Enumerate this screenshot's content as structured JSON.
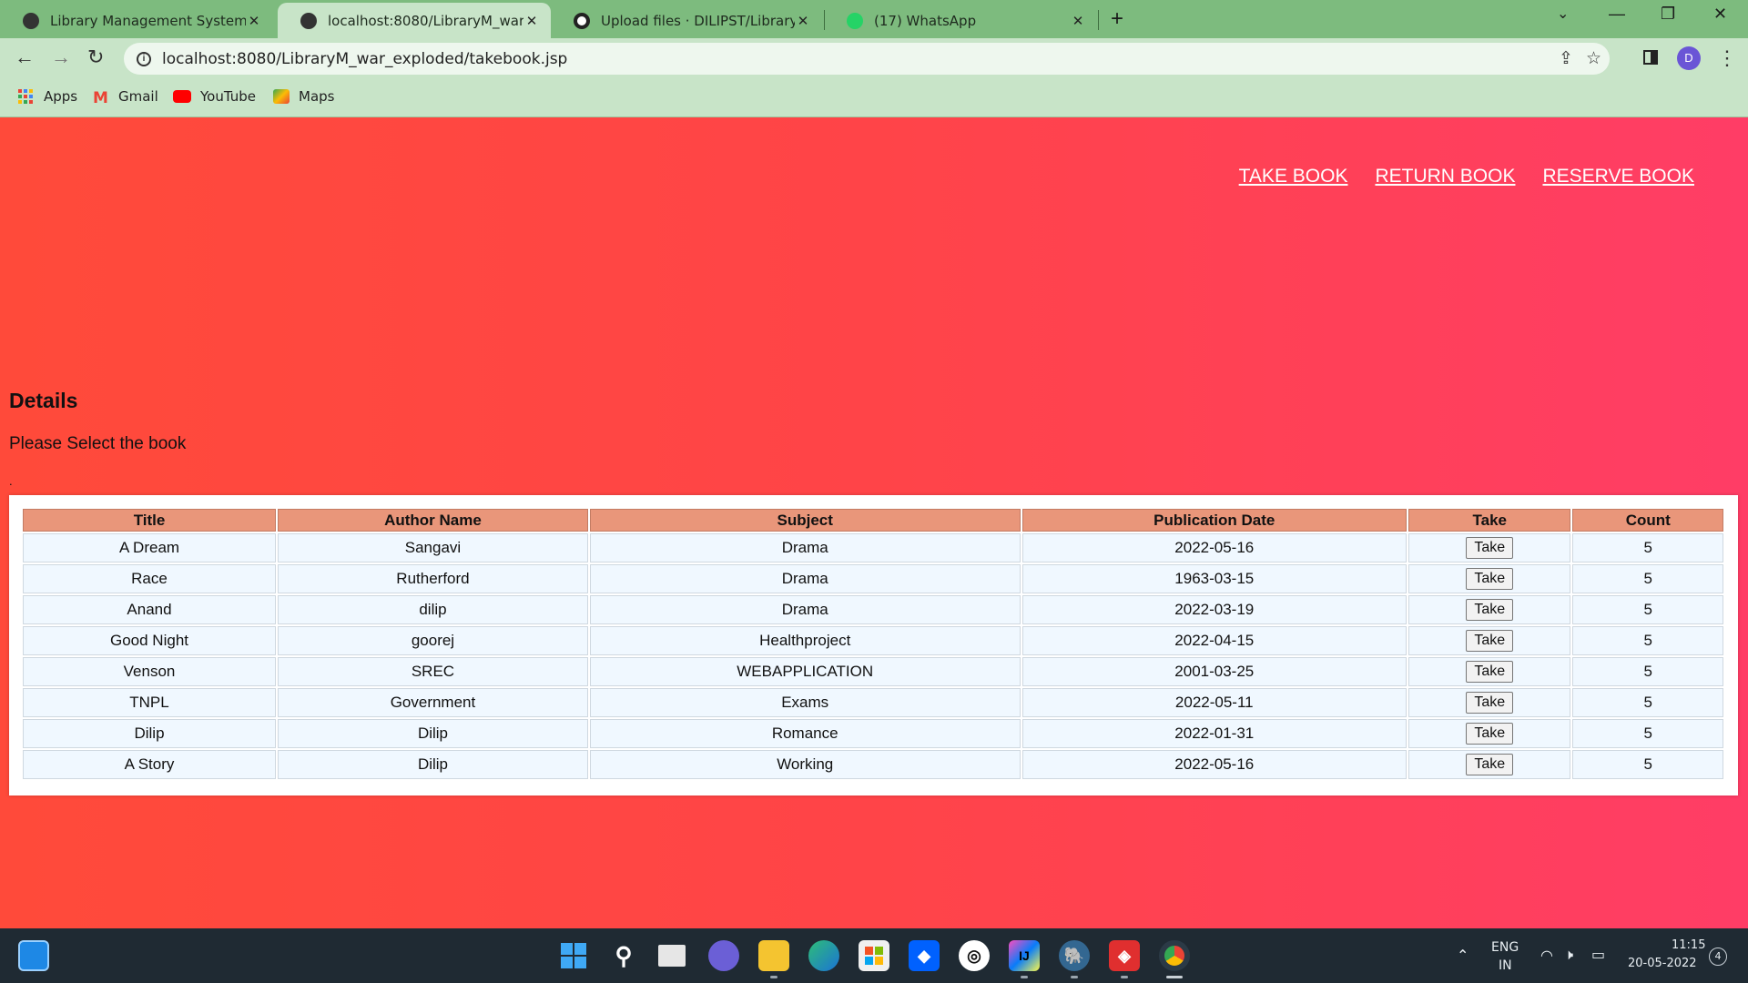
{
  "browser": {
    "tabs": [
      {
        "label": "Library Management System",
        "active": false
      },
      {
        "label": "localhost:8080/LibraryM_war_exp",
        "active": true
      },
      {
        "label": "Upload files · DILIPST/Library-Ma",
        "active": false
      },
      {
        "label": "(17) WhatsApp",
        "active": false
      }
    ],
    "url": "localhost:8080/LibraryM_war_exploded/takebook.jsp",
    "avatar_letter": "D",
    "bookmarks": [
      "Apps",
      "Gmail",
      "YouTube",
      "Maps"
    ]
  },
  "nav": {
    "links": [
      "TAKE BOOK",
      "RETURN BOOK",
      "RESERVE BOOK"
    ]
  },
  "main": {
    "heading": "Details",
    "subheading": "Please Select the book",
    "dot": "."
  },
  "table": {
    "headers": [
      "Title",
      "Author Name",
      "Subject",
      "Publication Date",
      "Take",
      "Count"
    ],
    "button_label": "Take",
    "rows": [
      {
        "title": "A Dream",
        "author": "Sangavi",
        "subject": "Drama",
        "date": "2022-05-16",
        "count": "5"
      },
      {
        "title": "Race",
        "author": "Rutherford",
        "subject": "Drama",
        "date": "1963-03-15",
        "count": "5"
      },
      {
        "title": "Anand",
        "author": "dilip",
        "subject": "Drama",
        "date": "2022-03-19",
        "count": "5"
      },
      {
        "title": "Good Night",
        "author": "goorej",
        "subject": "Healthproject",
        "date": "2022-04-15",
        "count": "5"
      },
      {
        "title": "Venson",
        "author": "SREC",
        "subject": "WEBAPPLICATION",
        "date": "2001-03-25",
        "count": "5"
      },
      {
        "title": "TNPL",
        "author": "Government",
        "subject": "Exams",
        "date": "2022-05-11",
        "count": "5"
      },
      {
        "title": "Dilip",
        "author": "Dilip",
        "subject": "Romance",
        "date": "2022-01-31",
        "count": "5"
      },
      {
        "title": "A Story",
        "author": "Dilip",
        "subject": "Working",
        "date": "2022-05-16",
        "count": "5"
      }
    ]
  },
  "taskbar": {
    "lang_top": "ENG",
    "lang_bottom": "IN",
    "time": "11:15",
    "date": "20-05-2022",
    "notification_count": "4"
  },
  "colors": {
    "page_gradient_left": "#ff4a3a",
    "page_gradient_right": "#ff3d66",
    "table_header": "#e9967a",
    "table_cell": "#f0f8ff",
    "chrome_frame": "#7dbb7e"
  }
}
